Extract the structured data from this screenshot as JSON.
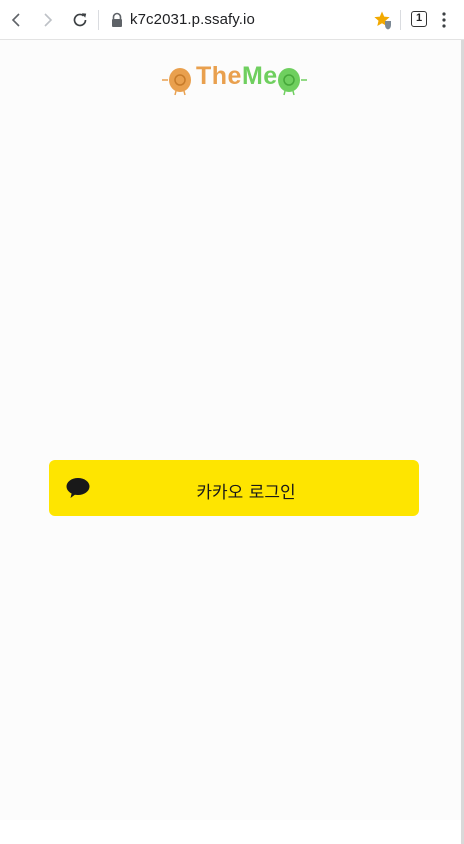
{
  "browser": {
    "url": "k7c2031.p.ssafy.io",
    "tab_count": "1"
  },
  "logo": {
    "text_the": "The",
    "text_me": "Me"
  },
  "login": {
    "kakao_label": "카카오 로그인"
  },
  "colors": {
    "kakao_yellow": "#fee500",
    "logo_orange": "#e9a04e",
    "logo_green": "#6fcf5f"
  }
}
